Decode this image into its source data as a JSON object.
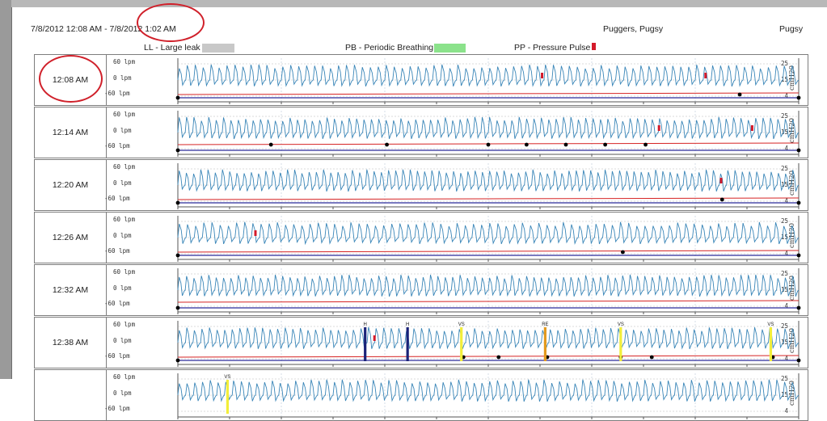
{
  "header": {
    "date_range": "7/8/2012  12:08 AM - 7/8/2012  1:02 AM",
    "patient": "Puggers, Pugsy",
    "short_name": "Pugsy"
  },
  "legend": [
    {
      "label": "LL - Large leak",
      "color": "#c8c8c8"
    },
    {
      "label": "PB - Periodic Breathing",
      "color": "#8be28b"
    },
    {
      "label": "PP - Pressure Pulse",
      "color": "#d41a2a"
    }
  ],
  "axes": {
    "left_ticks": [
      "60",
      "0",
      "-60"
    ],
    "left_unit": "lpm",
    "right_ticks": [
      "25",
      "15",
      "4"
    ],
    "right_unit": "cmH20"
  },
  "colors": {
    "flow": "#3a86b8",
    "pressure": "#d62424",
    "leak": "#2a2a9a",
    "event_dot": "#000000",
    "H": "#1a2277",
    "VS": "#f2ee3a",
    "RE": "#e39a1e",
    "PP": "#d41a2a"
  },
  "chart_data": {
    "type": "line",
    "x_range_minutes": [
      0,
      6
    ],
    "left_ylim": [
      -60,
      60
    ],
    "right_ylim": [
      4,
      25
    ],
    "rows": [
      {
        "time": "12:08 AM",
        "breath_count": 78,
        "events": [
          {
            "type": "PP",
            "t": 3.52
          },
          {
            "type": "PP",
            "t": 5.1
          }
        ],
        "leak_dots": [
          0.0,
          5.43,
          6.0
        ]
      },
      {
        "time": "12:14 AM",
        "breath_count": 84,
        "events": [
          {
            "type": "PP",
            "t": 4.65
          },
          {
            "type": "PP",
            "t": 5.55
          }
        ],
        "leak_dots": [
          0.0,
          0.9,
          2.02,
          3.0,
          3.37,
          3.75,
          4.13,
          4.52,
          6.0
        ]
      },
      {
        "time": "12:20 AM",
        "breath_count": 86,
        "events": [
          {
            "type": "PP",
            "t": 5.25
          }
        ],
        "leak_dots": [
          0.0,
          5.26,
          6.0
        ]
      },
      {
        "time": "12:26 AM",
        "breath_count": 76,
        "events": [
          {
            "type": "PP",
            "t": 0.75
          }
        ],
        "leak_dots": [
          0.0,
          4.3,
          6.0
        ]
      },
      {
        "time": "12:32 AM",
        "breath_count": 84,
        "events": [],
        "leak_dots": [
          0.0,
          6.0
        ]
      },
      {
        "time": "12:38 AM",
        "breath_count": 82,
        "events": [
          {
            "type": "H",
            "t": 1.81,
            "label": "H"
          },
          {
            "type": "H",
            "t": 2.22,
            "label": "H"
          },
          {
            "type": "VS",
            "t": 2.74,
            "label": "VS"
          },
          {
            "type": "RE",
            "t": 3.55,
            "label": "RE"
          },
          {
            "type": "VS",
            "t": 4.28,
            "label": "VS"
          },
          {
            "type": "VS",
            "t": 5.73,
            "label": "VS"
          },
          {
            "type": "PP",
            "t": 1.9
          }
        ],
        "leak_dots": [
          0.0,
          2.76,
          3.1,
          3.57,
          4.28,
          4.58,
          5.75,
          6.0
        ]
      },
      {
        "time": "",
        "breath_count": 80,
        "events": [
          {
            "type": "VS",
            "t": 0.48,
            "label": "VS"
          }
        ],
        "leak_dots": [],
        "partial": true
      }
    ]
  }
}
